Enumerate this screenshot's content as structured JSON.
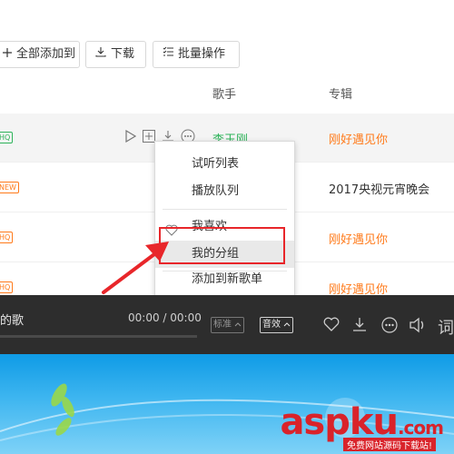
{
  "toolbar": {
    "add_all_label": "全部添加到",
    "download_label": "下载",
    "batch_label": "批量操作"
  },
  "columns": {
    "artist": "歌手",
    "album": "专辑"
  },
  "rows": [
    {
      "badge": "HQ",
      "artist": "李玉刚",
      "album": "刚好遇见你"
    },
    {
      "badge": "NEW",
      "album": "2017央视元宵晚会"
    },
    {
      "badge": "HQ",
      "album": "刚好遇见你"
    },
    {
      "badge": "HQ",
      "album": "刚好遇见你"
    }
  ],
  "context_menu": {
    "items": [
      "试听列表",
      "播放队列",
      "我喜欢",
      "我的分组",
      "添加到新歌单"
    ],
    "active_index": 3
  },
  "player": {
    "title": "的歌",
    "time": "00:00 / 00:00",
    "quality": "标准",
    "effect": "音效",
    "lyrics": "词",
    "progress": 0
  },
  "watermark": {
    "text": "aspku",
    "domain": ".com",
    "sub": "免费网站源码下载站!"
  },
  "colors": {
    "accent": "#ff7a1a",
    "green": "#2eb35a",
    "highlight_box": "#e8262a",
    "player_bg": "#2d2d2d"
  }
}
